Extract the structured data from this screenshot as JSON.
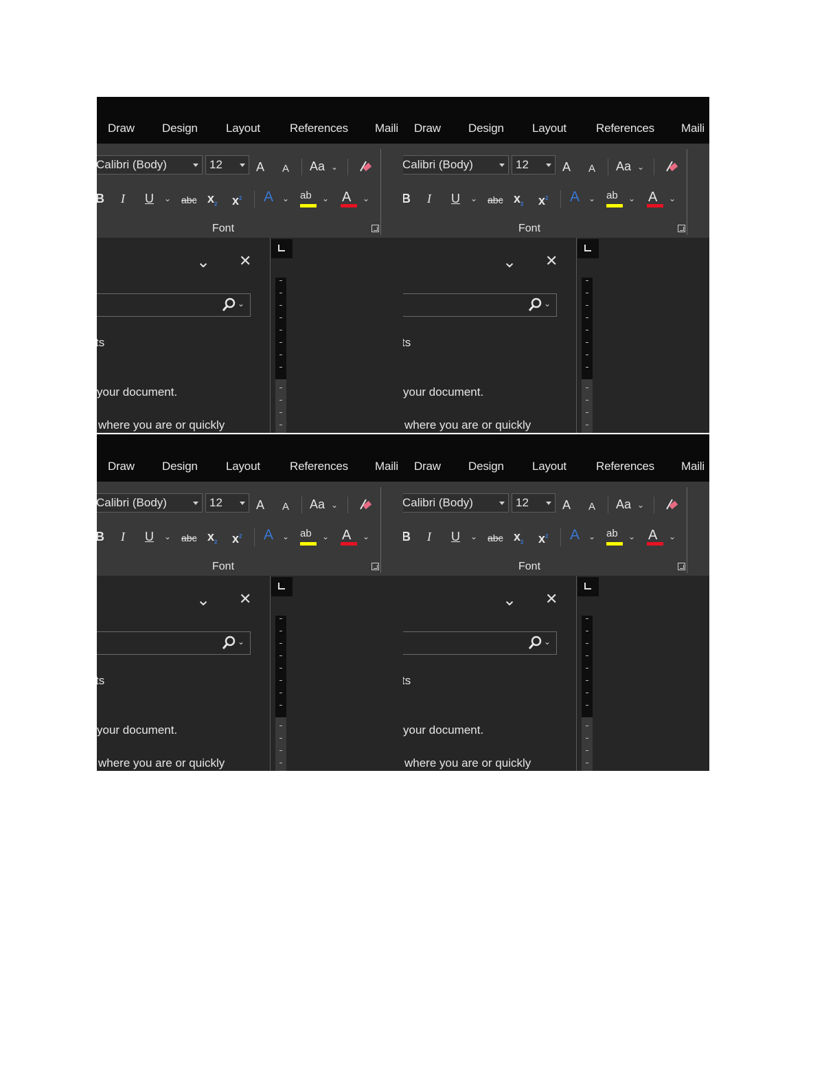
{
  "tabs": [
    "Draw",
    "Design",
    "Layout",
    "References",
    "Maili"
  ],
  "font_group": {
    "font_name": "Calibri (Body)",
    "font_size": "12",
    "change_case": "Aa",
    "subscript_letter": "x",
    "superscript_letter": "x",
    "strikethrough": "abc",
    "highlight": "ab",
    "text_effects": "A",
    "font_color": "A",
    "bold": "B",
    "italic": "I",
    "underline": "U",
    "grow_font": "A",
    "shrink_font": "A",
    "label": "Font"
  },
  "colors": {
    "highlight_bar": "#ffff00",
    "font_color_bar": "#e81123",
    "text_effects": "#3a78d4",
    "eraser": "#e86b84"
  },
  "pane": {
    "line1": "ts",
    "line2": "your document.",
    "line3": "where you are or quickly"
  },
  "icons": [
    "chevron-down-icon",
    "close-icon",
    "search-icon",
    "ruler-tab-icon",
    "clear-formatting-icon",
    "dialog-launcher-icon"
  ]
}
